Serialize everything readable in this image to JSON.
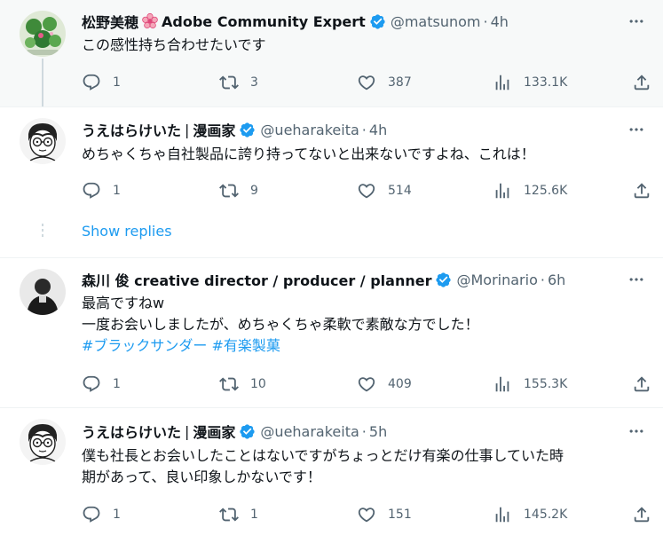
{
  "tweets": [
    {
      "name": "松野美穂",
      "title": "Adobe Community Expert",
      "handle": "@matsunom",
      "time": "4h",
      "lines": [
        "この感性持ち合わせたいです"
      ],
      "replies": "1",
      "retweets": "3",
      "likes": "387",
      "views": "133.1K"
    },
    {
      "name": "うえはらけいた",
      "title": "漫画家",
      "handle": "@ueharakeita",
      "time": "4h",
      "lines": [
        "めちゃくちゃ自社製品に誇り持ってないと出来ないですよね、これは！"
      ],
      "replies": "1",
      "retweets": "9",
      "likes": "514",
      "views": "125.6K"
    },
    {
      "name": "森川 俊 creative director / producer / planner",
      "handle": "@Morinario",
      "time": "6h",
      "lines": [
        "最高ですねw",
        "一度お会いしましたが、めちゃくちゃ柔軟で素敵な方でした！"
      ],
      "hashtags": [
        "#ブラックサンダー",
        "#有楽製菓"
      ],
      "replies": "1",
      "retweets": "10",
      "likes": "409",
      "views": "155.3K"
    },
    {
      "name": "うえはらけいた",
      "title": "漫画家",
      "handle": "@ueharakeita",
      "time": "5h",
      "lines": [
        "僕も社長とお会いしたことはないですがちょっとだけ有楽の仕事していた時",
        "期があって、良い印象しかないです！"
      ],
      "replies": "1",
      "retweets": "1",
      "likes": "151",
      "views": "145.2K"
    }
  ],
  "show_replies_label": "Show replies",
  "separators": {
    "dot": "·",
    "bar": "|"
  },
  "icons": [
    "reply-icon",
    "retweet-icon",
    "like-icon",
    "views-icon",
    "share-icon",
    "more-icon",
    "verified-badge-icon",
    "flower-icon"
  ],
  "colors": {
    "accent": "#1d9bf0",
    "muted": "#536471",
    "text": "#0f1419",
    "highlight_bg": "#f7f9f9"
  }
}
